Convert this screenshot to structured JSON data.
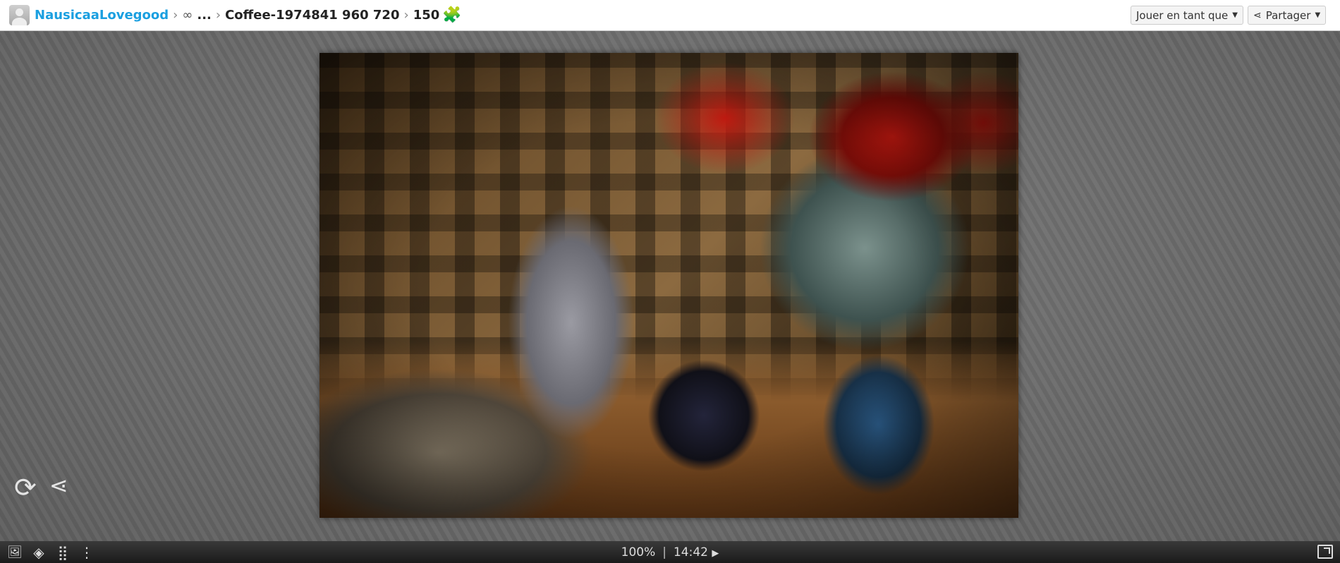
{
  "header": {
    "breadcrumb": {
      "user": "NausicaaLovegood",
      "ellipsis": "...",
      "album": "Coffee-1974841 960 720",
      "pieces": "150"
    },
    "play_as_label": "Jouer en tant que",
    "share_label": "Partager"
  },
  "footer": {
    "zoom": "100%",
    "separator": "|",
    "timer": "14:42"
  },
  "icons": {
    "separator": "›",
    "link": "🔗",
    "puzzle": "🧩",
    "refresh": "⟳",
    "share": "⋘",
    "caret": "▼",
    "play": "▶",
    "image": "🖼",
    "palette": "◈",
    "grid": "⣿",
    "more": "⋮"
  }
}
